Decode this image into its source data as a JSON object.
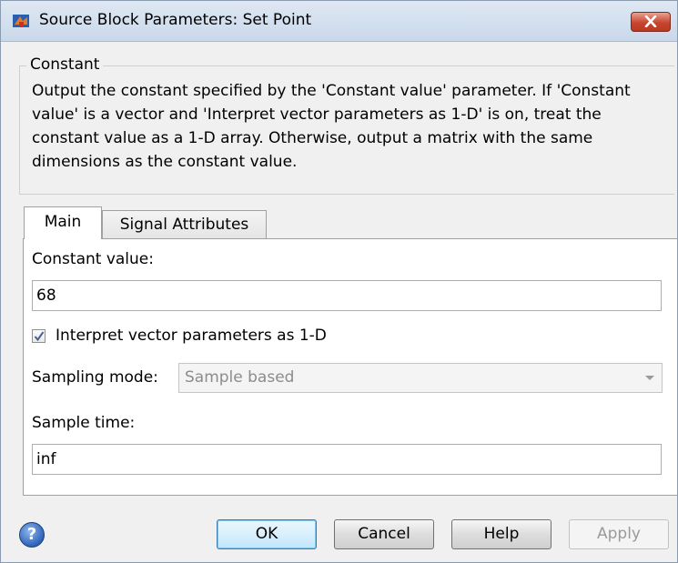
{
  "window": {
    "title": "Source Block Parameters: Set Point"
  },
  "description": {
    "group_title": "Constant",
    "text": "Output the constant specified by the 'Constant value' parameter. If 'Constant value' is a vector and 'Interpret vector parameters as 1-D' is on, treat the constant value as a 1-D array. Otherwise, output a matrix with the same dimensions as the constant value."
  },
  "tabs": [
    {
      "label": "Main",
      "active": true
    },
    {
      "label": "Signal Attributes",
      "active": false
    }
  ],
  "main": {
    "constant_value_label": "Constant value:",
    "constant_value": "68",
    "interpret_vector_label": "Interpret vector parameters as 1-D",
    "interpret_vector_checked": true,
    "sampling_mode_label": "Sampling mode:",
    "sampling_mode_value": "Sample based",
    "sample_time_label": "Sample time:",
    "sample_time_value": "inf"
  },
  "buttons": {
    "ok": "OK",
    "cancel": "Cancel",
    "help": "Help",
    "apply": "Apply",
    "help_icon": "?"
  },
  "icons": {
    "app": "simulink-block-icon",
    "close": "close-icon",
    "help": "help-icon",
    "dropdown": "chevron-down-icon",
    "checkbox": "checkmark-icon"
  }
}
